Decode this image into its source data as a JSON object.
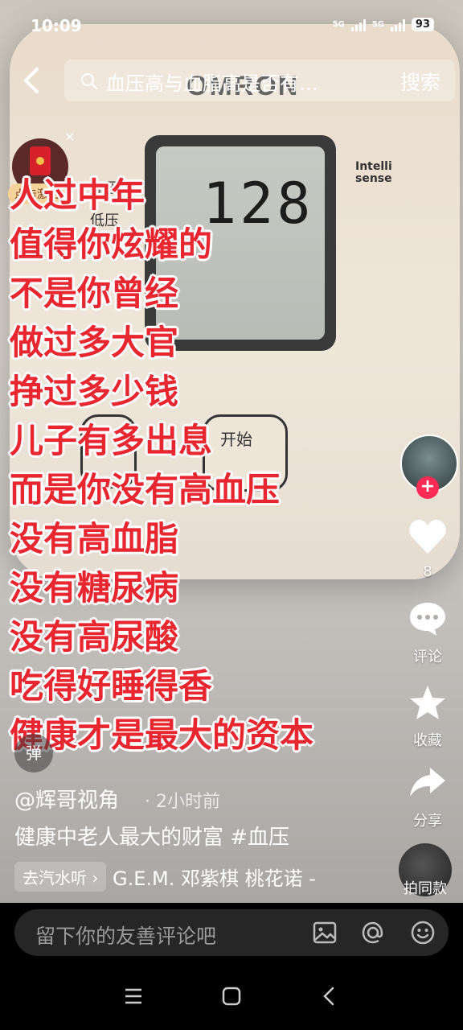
{
  "status_bar": {
    "time": "10:09",
    "signal_1": "5G",
    "signal_2": "5G",
    "battery": "93"
  },
  "video": {
    "device_brand": "OMRON",
    "lcd_value": "128",
    "badge_line1": "Intelli",
    "badge_line2": "sense",
    "device_label_1": "高压",
    "device_label_2": "低压",
    "start_button_label": "开始"
  },
  "search": {
    "query": "血压高与血脂高是否有…",
    "button": "搜索"
  },
  "promo": {
    "label": "点击激活",
    "close": "×"
  },
  "overlay_lines": [
    "人过中年",
    "值得你炫耀的",
    "不是你曾经",
    "做过多大官",
    "挣过多少钱",
    "儿子有多出息",
    "而是你没有高血压",
    "没有高血脂",
    "没有糖尿病",
    "没有高尿酸",
    "吃得好睡得香",
    "健康才是最大的资本"
  ],
  "danmu": "弹",
  "rail": {
    "likes": "8",
    "comment": "评论",
    "favorite": "收藏",
    "share": "分享",
    "follow": "+"
  },
  "post": {
    "author": "@辉哥视角",
    "time_ago": "· 2小时前",
    "description": "健康中老人最大的财富 #血压",
    "music_chip": "去汽水听 ›",
    "music_text": "G.E.M. 邓紫棋     桃花诺 -",
    "same_style": "拍同款"
  },
  "comment_bar": {
    "placeholder": "留下你的友善评论吧"
  },
  "colors": {
    "overlay_text": "#e8262f",
    "follow_badge": "#fe2c55"
  }
}
